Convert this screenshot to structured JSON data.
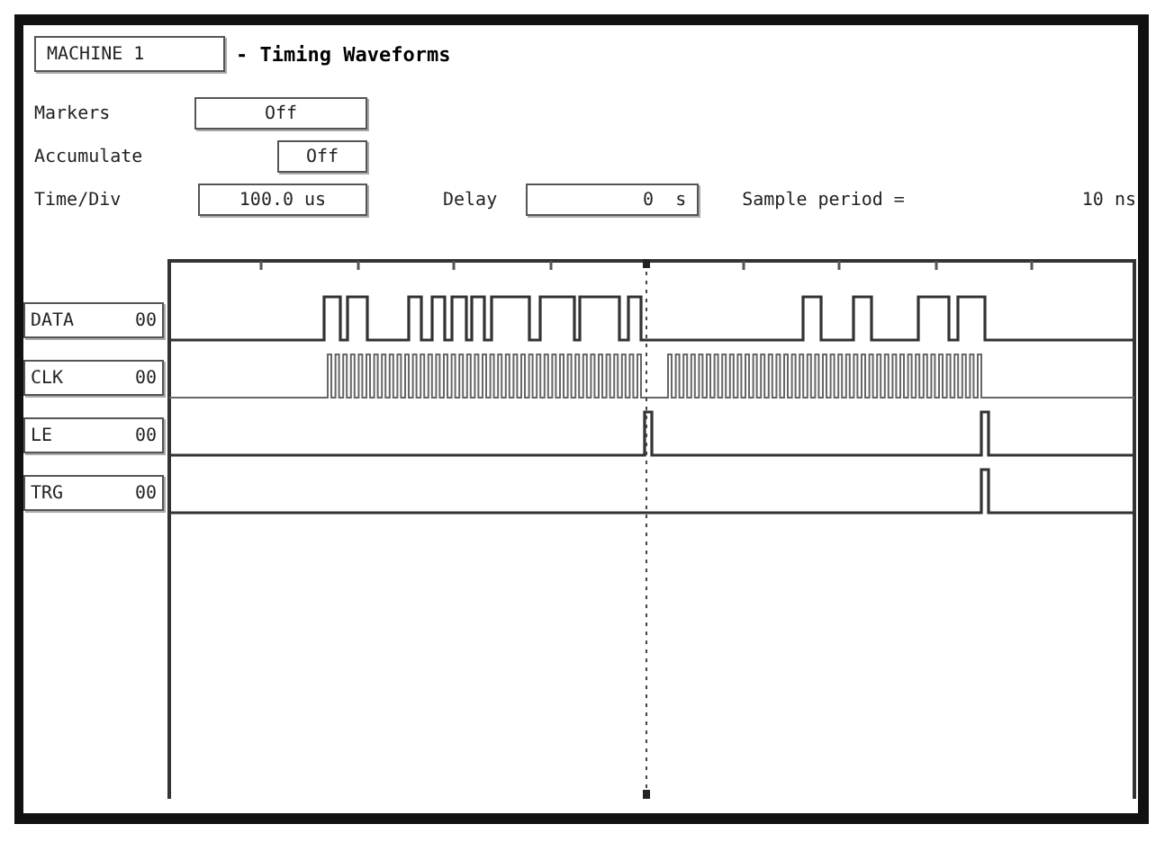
{
  "header": {
    "machine": "MACHINE 1",
    "title": "- Timing Waveforms"
  },
  "settings": [
    {
      "label": "Markers",
      "value": "Off"
    },
    {
      "label": "Accumulate",
      "value": "Off"
    },
    {
      "label": "Time/Div",
      "value": "100.0 us"
    }
  ],
  "delay": {
    "label": "Delay",
    "value": "0  s"
  },
  "sample_period": {
    "label": "Sample period =",
    "value": "10 ns"
  },
  "signals": [
    {
      "name": "DATA",
      "value": "00"
    },
    {
      "name": "CLK",
      "value": "00"
    },
    {
      "name": "LE",
      "value": "00"
    },
    {
      "name": "TRG",
      "value": "00"
    }
  ]
}
